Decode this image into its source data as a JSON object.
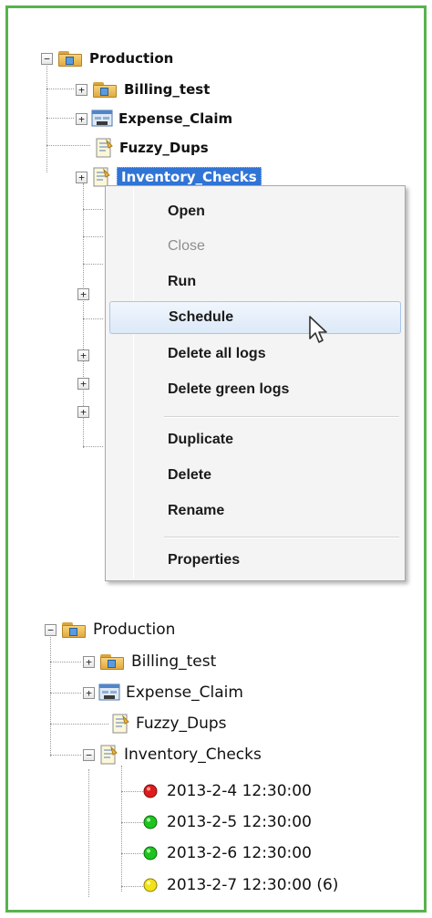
{
  "top_tree": {
    "root_label": "Production",
    "children": [
      {
        "label": "Billing_test"
      },
      {
        "label": "Expense_Claim"
      },
      {
        "label": "Fuzzy_Dups"
      },
      {
        "label": "Inventory_Checks"
      }
    ]
  },
  "context_menu": {
    "items": [
      {
        "label": "Open"
      },
      {
        "label": "Close",
        "disabled": true
      },
      {
        "label": "Run"
      },
      {
        "label": "Schedule",
        "hover": true
      },
      {
        "label": "Delete all logs"
      },
      {
        "label": "Delete green logs"
      },
      {
        "label": "Duplicate"
      },
      {
        "label": "Delete"
      },
      {
        "label": "Rename"
      },
      {
        "label": "Properties"
      }
    ]
  },
  "bottom_tree": {
    "root_label": "Production",
    "children": [
      {
        "label": "Billing_test"
      },
      {
        "label": "Expense_Claim"
      },
      {
        "label": "Fuzzy_Dups"
      },
      {
        "label": "Inventory_Checks"
      }
    ],
    "logs": [
      {
        "label": "2013-2-4 12:30:00",
        "status_color": "#e01b1b"
      },
      {
        "label": "2013-2-5 12:30:00",
        "status_color": "#1ec41e"
      },
      {
        "label": "2013-2-6 12:30:00",
        "status_color": "#1ec41e"
      },
      {
        "label": "2013-2-7 12:30:00 (6)",
        "status_color": "#f2e21a"
      }
    ]
  },
  "colors": {
    "frame_border": "#58b24e",
    "selection": "#3074d6",
    "menu_hover": "#dce9f8"
  }
}
